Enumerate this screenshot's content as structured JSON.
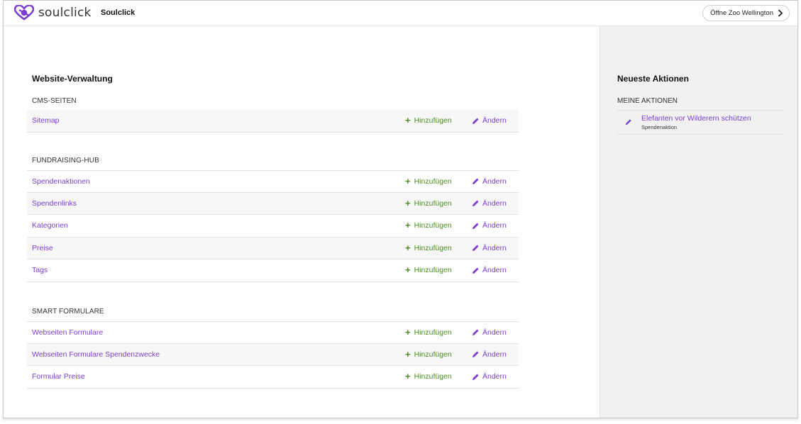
{
  "header": {
    "logo_text": "soulclick",
    "app_title": "Soulclick",
    "open_button": "Öffne Zoo Wellington"
  },
  "main": {
    "title": "Website-Verwaltung",
    "add_label": "Hinzufügen",
    "edit_label": "Ändern",
    "sections": [
      {
        "label": "CMS-SEITEN",
        "rows": [
          "Sitemap"
        ]
      },
      {
        "label": "FUNDRAISING-HUB",
        "rows": [
          "Spendenaktionen",
          "Spendenlinks",
          "Kategorien",
          "Preise",
          "Tags"
        ]
      },
      {
        "label": "SMART FORMULARE",
        "rows": [
          "Webseiten Formulare",
          "Webseiten Formulare Spendenzwecke",
          "Formular Preise"
        ]
      }
    ]
  },
  "sidebar": {
    "title": "Neueste Aktionen",
    "section_label": "MEINE AKTIONEN",
    "items": [
      {
        "title": "Elefanten vor Wilderern schützen",
        "subtitle": "Spendenaktion"
      }
    ]
  },
  "colors": {
    "accent": "#7b3fd0",
    "add_green": "#4a8d1f",
    "sidebar_bg": "#f1f1f1"
  }
}
